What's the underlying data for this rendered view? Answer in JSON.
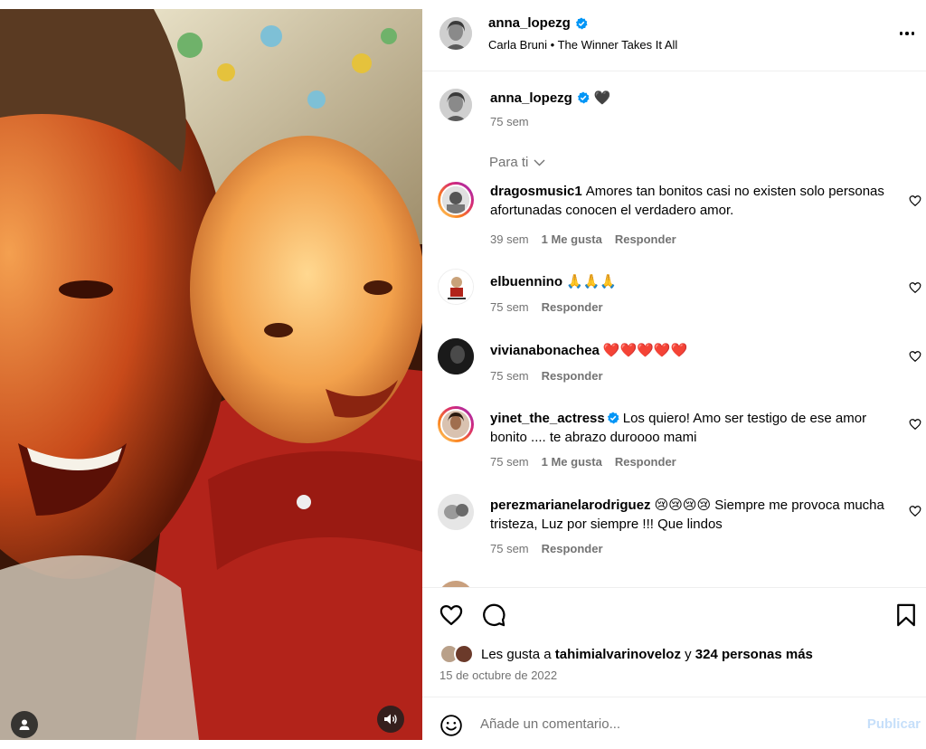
{
  "post": {
    "username": "anna_lopezg",
    "audio": "Carla Bruni • The Winner Takes It All",
    "caption_emoji": "🖤",
    "caption_time": "75 sem",
    "for_you": "Para ti",
    "date": "15 de octubre de 2022"
  },
  "comments": [
    {
      "username": "dragosmusic1",
      "text": "Amores tan bonitos casi no existen solo personas afortunadas conocen el verdadero amor.",
      "time": "39 sem",
      "likes": "1 Me gusta",
      "reply": "Responder",
      "verified": false
    },
    {
      "username": "elbuennino",
      "text": "🙏🙏🙏",
      "time": "75 sem",
      "likes": "",
      "reply": "Responder",
      "verified": false
    },
    {
      "username": "vivianabonachea",
      "text": "❤️❤️❤️❤️❤️",
      "time": "75 sem",
      "likes": "",
      "reply": "Responder",
      "verified": false
    },
    {
      "username": "yinet_the_actress",
      "text": "Los quiero! Amo ser testigo de ese amor bonito .... te abrazo duroooo mami",
      "time": "75 sem",
      "likes": "1 Me gusta",
      "reply": "Responder",
      "verified": true
    },
    {
      "username": "perezmarianelarodriguez",
      "text": "😢😢😢😢 Siempre me provoca mucha tristeza, Luz por siempre !!! Que lindos",
      "time": "75 sem",
      "likes": "",
      "reply": "Responder",
      "verified": false
    }
  ],
  "likes": {
    "prefix": "Les gusta a",
    "user": "tahimialvarinoveloz",
    "joiner": "y",
    "others": "324 personas más"
  },
  "add_comment": {
    "placeholder": "Añade un comentario...",
    "post_label": "Publicar"
  },
  "colors": {
    "verified": "#0095f6",
    "secondary_text": "#737373",
    "post_disabled": "#c6dffa"
  },
  "icons": {
    "like": "heart-icon",
    "comment": "comment-bubble-icon",
    "save": "bookmark-icon",
    "emoji": "smiley-icon",
    "more": "ellipsis-icon",
    "audio": "speaker-icon",
    "tag": "user-tag-icon"
  }
}
